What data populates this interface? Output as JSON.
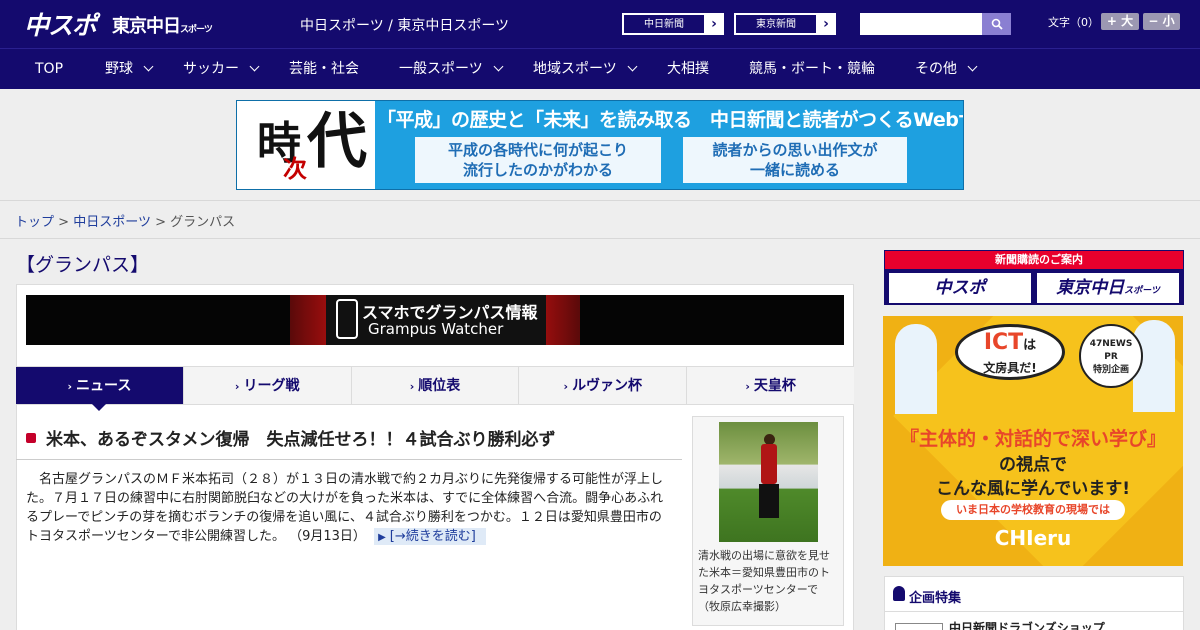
{
  "header": {
    "logo_primary": "中スポ",
    "logo_secondary": "東京中日",
    "logo_secondary_small": "スポーツ",
    "site_title": "中日スポーツ / 東京中日スポーツ",
    "link_chunichi": "中日新聞",
    "link_tokyo": "東京新聞",
    "link_arrow": "›",
    "search_placeholder": "",
    "font_size_label": "文字（0）",
    "font_bigger": "+ 大",
    "font_smaller": "− 小"
  },
  "nav": {
    "items": [
      {
        "label": "TOP"
      },
      {
        "label": "野球"
      },
      {
        "label": "サッカー"
      },
      {
        "label": "芸能・社会"
      },
      {
        "label": "一般スポーツ"
      },
      {
        "label": "地域スポーツ"
      },
      {
        "label": "大相撲"
      },
      {
        "label": "競馬・ボート・競輪"
      },
      {
        "label": "その他"
      }
    ]
  },
  "banner": {
    "kanji_1": "時",
    "kanji_2": "次",
    "kanji_3": "代",
    "headline": "「平成」の歴史と「未来」を読み取る　中日新聞と読者がつくるWebサイト",
    "box_left_1": "平成の各時代に何が起こり",
    "box_left_2": "流行したのかがわかる",
    "box_right_1": "読者からの思い出作文が",
    "box_right_2": "一緒に読める"
  },
  "breadcrumb": {
    "home": "トップ",
    "sep": ">",
    "parent": "中日スポーツ",
    "current": "グランパス"
  },
  "section_title": "【グランパス】",
  "promo": {
    "line1": "スマホでグランパス情報",
    "line2": "Grampus Watcher"
  },
  "tabs": [
    {
      "label": "ニュース"
    },
    {
      "label": "リーグ戦"
    },
    {
      "label": "順位表"
    },
    {
      "label": "ルヴァン杯"
    },
    {
      "label": "天皇杯"
    }
  ],
  "tab_marker": "›",
  "article": {
    "headline": "米本、あるぞスタメン復帰　失点減任せろ！！４試合ぶり勝利必ず",
    "body": "　名古屋グランパスのＭＦ米本拓司（２８）が１３日の清水戦で約２カ月ぶりに先発復帰する可能性が浮上した。７月１７日の練習中に右肘関節脱臼などの大けがを負った米本は、すでに全体練習へ合流。闘争心あふれるプレーでピンチの芽を摘むボランチの復帰を追い風に、４試合ぶり勝利をつかむ。１２日は愛知県豊田市のトヨタスポーツセンターで非公開練習した。",
    "date": "（9月13日）",
    "read_more": "[→続きを読む]",
    "photo_caption": "清水戦の出場に意欲を見せた米本＝愛知県豊田市のトヨタスポーツセンターで（牧原広幸撮影）"
  },
  "sidebar": {
    "subscribe_label": "新聞購読のご案内",
    "sub_left": "中スポ",
    "sub_right": "東京中日",
    "sub_right_small": "スポーツ",
    "ad": {
      "ict_big": "ICT",
      "ict_mid": "は",
      "ict_small": "文房具だ!",
      "pr_1": "47NEWS",
      "pr_2": "PR",
      "pr_3": "特別企画",
      "line1": "『主体的・対話的で深い学び』",
      "line2": "の視点で",
      "line3": "こんな風に学んでいます!",
      "line4": "いま日本の学校教育の現場では",
      "line5": "CHIeru"
    },
    "feature_title": "企画特集",
    "feature_item": "中日新聞ドラゴンズショップ"
  }
}
